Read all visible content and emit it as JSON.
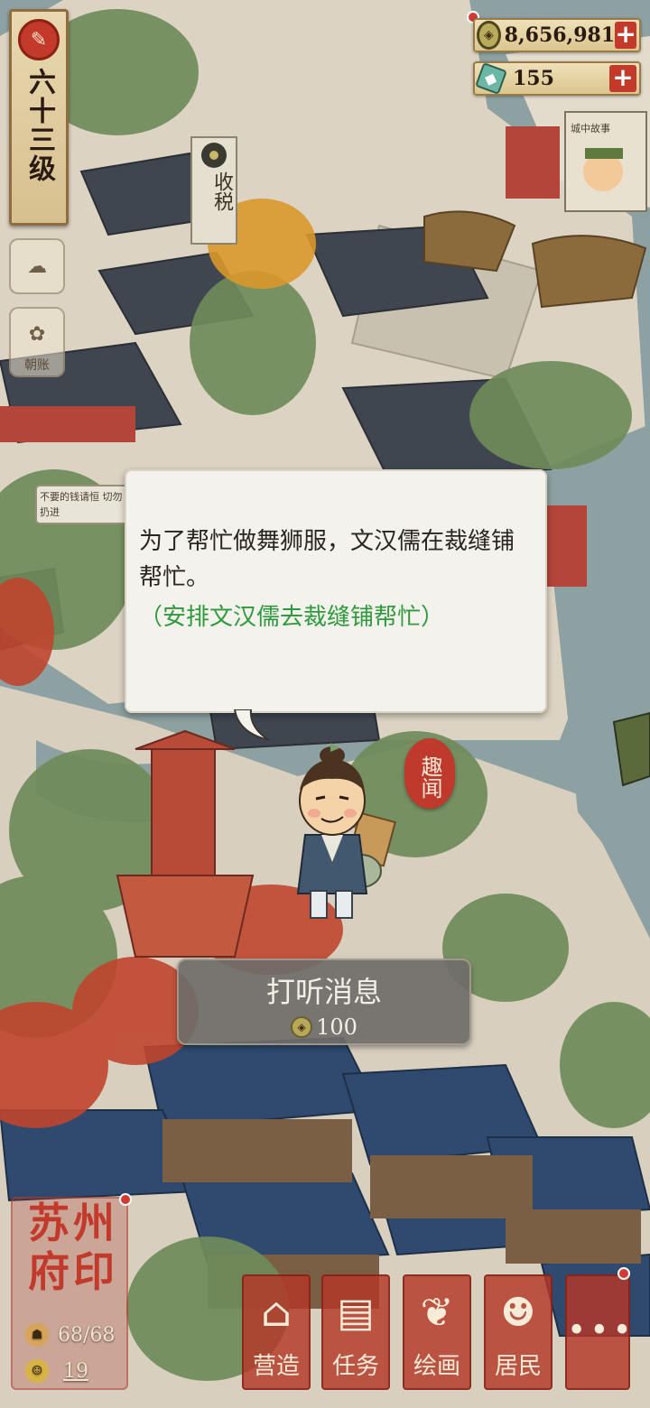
{
  "level": {
    "text": "六十三级"
  },
  "side_buttons": [
    {
      "label": ""
    },
    {
      "label": "朝账"
    }
  ],
  "currency": {
    "coins": "8,656,981",
    "gems": "155",
    "plus": "+"
  },
  "map_signs": {
    "tax": "收税",
    "story": "城中故事",
    "notice": "不要的钱请恒 切勿扔进"
  },
  "dialog": {
    "text": "为了帮忙做舞狮服，文汉儒在裁缝铺帮忙。",
    "action": "（安排文汉儒去裁缝铺帮忙）"
  },
  "gossip_tag": "趣闻",
  "inquire": {
    "title": "打听消息",
    "cost": "100"
  },
  "seal": {
    "title": "苏州府印",
    "stat1": "68/68",
    "stat2": "19"
  },
  "nav": [
    {
      "label": "营造",
      "icon": "construction-icon"
    },
    {
      "label": "任务",
      "icon": "task-icon"
    },
    {
      "label": "绘画",
      "icon": "painting-icon"
    },
    {
      "label": "居民",
      "icon": "residents-icon"
    },
    {
      "label": "",
      "icon": "more-icon"
    }
  ],
  "colors": {
    "seal_red": "#c23a2c",
    "action_green": "#2f9a3d",
    "water": "#8fa2a3"
  }
}
